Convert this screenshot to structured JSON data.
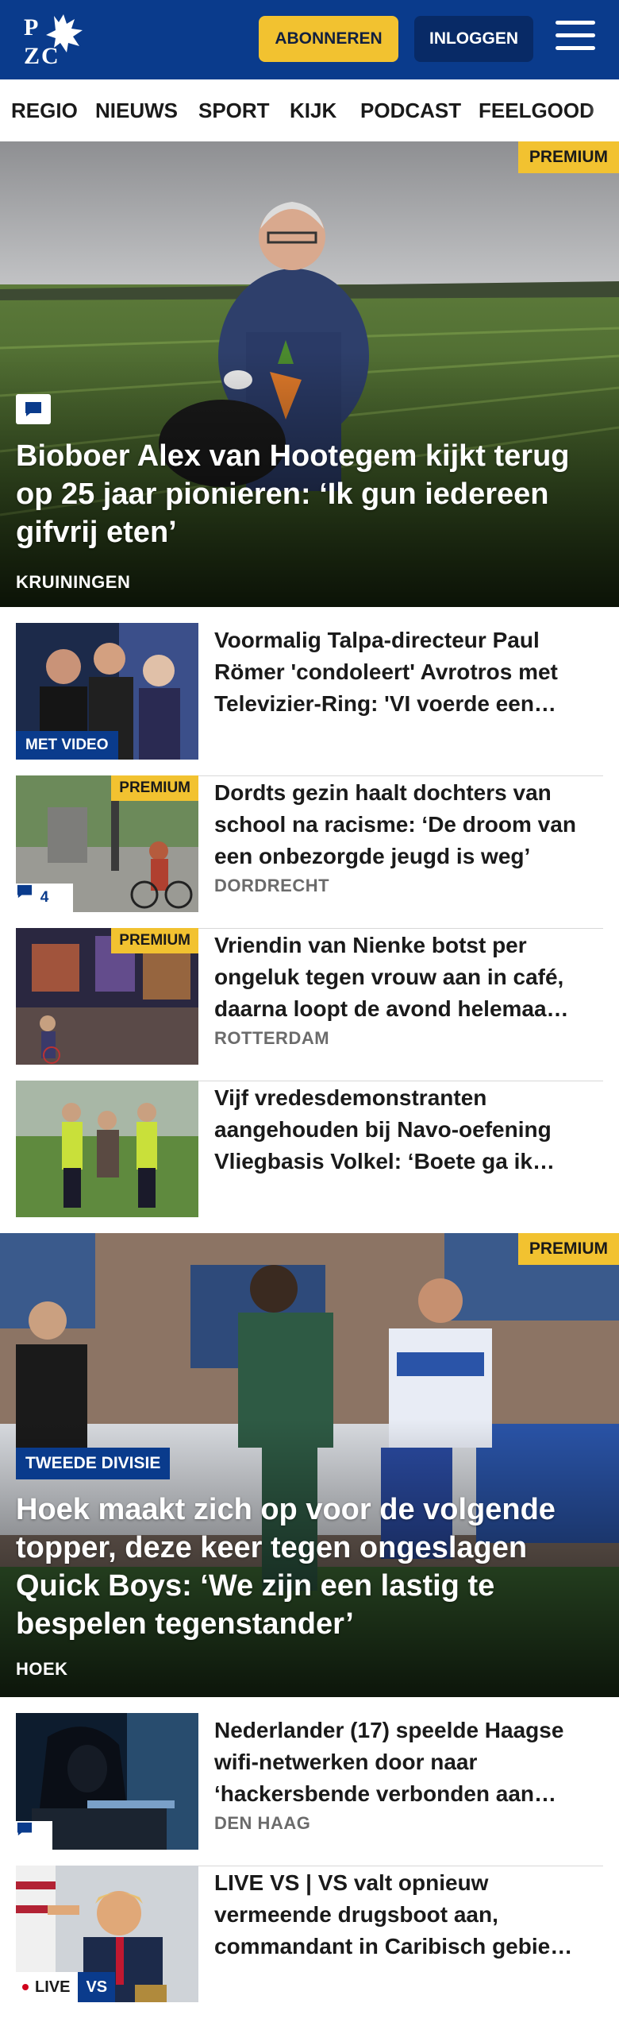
{
  "header": {
    "logo_text": "PZC",
    "subscribe_label": "ABONNEREN",
    "login_label": "INLOGGEN"
  },
  "nav": {
    "items": [
      "REGIO",
      "NIEUWS",
      "SPORT",
      "KIJK",
      "PODCAST",
      "FEELGOOD"
    ]
  },
  "hero1": {
    "badge": "PREMIUM",
    "title": "Bioboer Alex van Hootegem kijkt terug op 25 jaar pionieren: ‘Ik gun iedereen gifvrij eten’",
    "location": "KRUININGEN"
  },
  "articles1": [
    {
      "title": "Voormalig Talpa-directeur Paul Römer 'condoleert' Avrotros met Televizier-Ring: 'VI voerde een…",
      "location": "",
      "video_label": "MET VIDEO"
    },
    {
      "title": "Dordts gezin haalt dochters van school na racisme: ‘De droom van een onbezorgde jeugd is weg’",
      "location": "DORDRECHT",
      "premium": "PREMIUM",
      "comments": "4"
    },
    {
      "title": "Vriendin van Nienke botst per ongeluk tegen vrouw aan in café, daarna loopt de avond helemaa…",
      "location": "ROTTERDAM",
      "premium": "PREMIUM"
    },
    {
      "title": "Vijf vredesdemonstranten aangehouden bij Navo-oefening Vliegbasis Volkel: ‘Boete ga ik…",
      "location": ""
    }
  ],
  "hero2": {
    "badge": "PREMIUM",
    "category": "TWEEDE DIVISIE",
    "title": "Hoek maakt zich op voor de volgende topper, deze keer tegen ongeslagen Quick Boys: ‘We zijn een lastig te bespelen tegenstander’",
    "location": "HOEK"
  },
  "articles2": [
    {
      "title": "Nederlander (17) speelde Haagse wifi-netwerken door naar ‘hackersbende verbonden aan…",
      "location": "DEN HAAG"
    },
    {
      "title": "LIVE VS | VS valt opnieuw vermeende drugsboot aan, commandant in Caribisch gebie…",
      "location": "",
      "live_label": "LIVE",
      "vs_label": "VS"
    }
  ],
  "colors": {
    "brand_blue": "#0a3b8c",
    "accent_yellow": "#f2c230"
  }
}
